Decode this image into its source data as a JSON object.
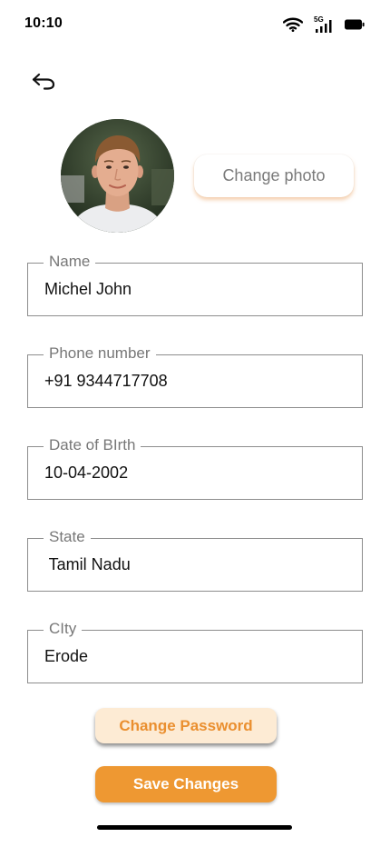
{
  "status_bar": {
    "time": "10:10",
    "network_label": "5G"
  },
  "profile": {
    "change_photo_label": "Change photo"
  },
  "fields": [
    {
      "label": "Name",
      "value": "Michel John"
    },
    {
      "label": "Phone number",
      "value": "+91 9344717708"
    },
    {
      "label": "Date of BIrth",
      "value": "10-04-2002"
    },
    {
      "label": "State",
      "value": " Tamil Nadu"
    },
    {
      "label": "CIty",
      "value": "Erode"
    }
  ],
  "actions": {
    "change_password_label": "Change Password",
    "save_changes_label": "Save Changes"
  },
  "colors": {
    "accent": "#EE9832",
    "accent_light": "#FDEBD4",
    "accent_text": "#EA8F2F"
  },
  "icons": {
    "back": "undo-arrow-icon",
    "wifi": "wifi-icon",
    "signal": "cellular-signal-icon",
    "battery": "battery-icon"
  }
}
